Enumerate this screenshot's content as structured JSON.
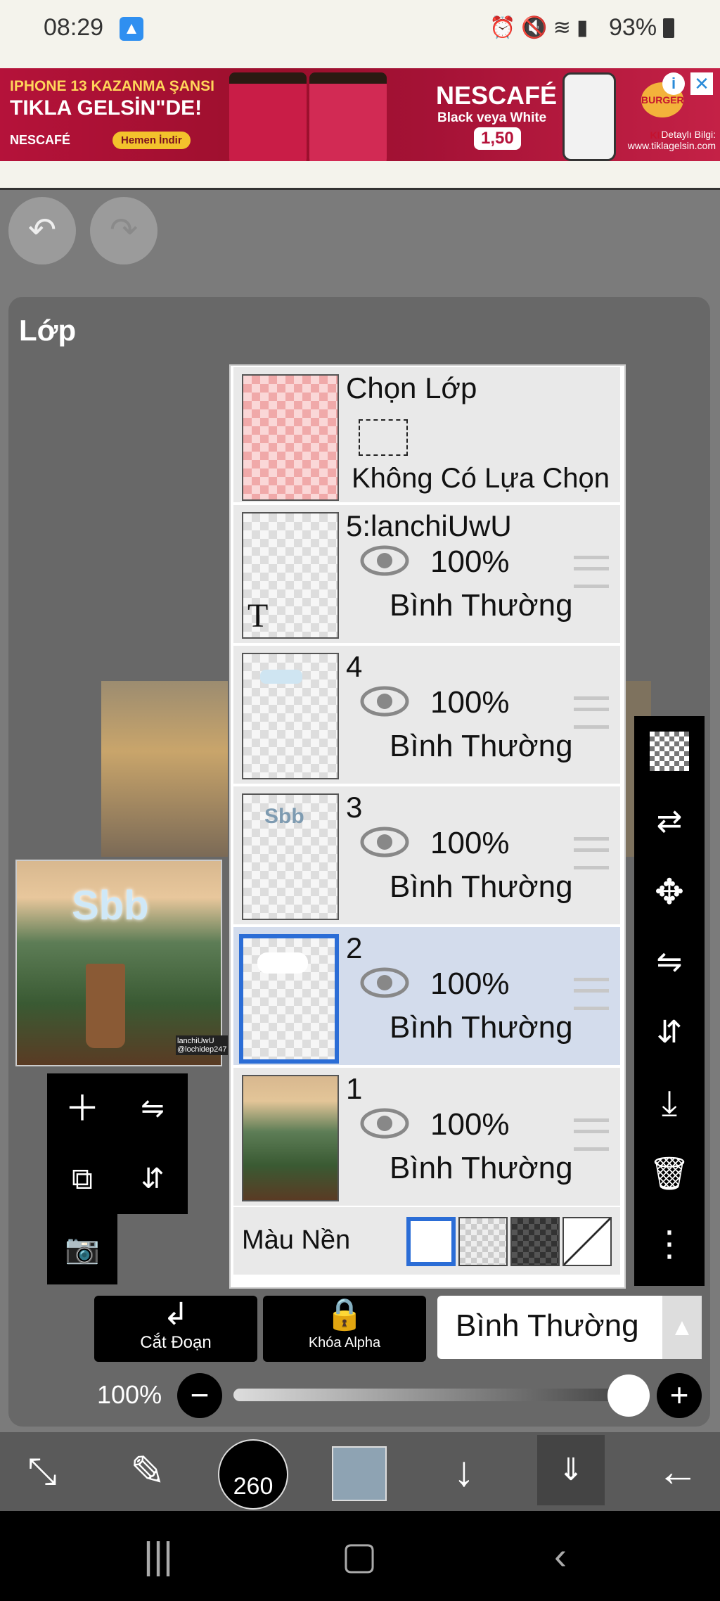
{
  "status": {
    "time": "08:29",
    "battery": "93%",
    "icons": [
      "alarm-icon",
      "mute-icon",
      "wifi-icon",
      "signal-icon"
    ]
  },
  "ad": {
    "line1": "IPHONE 13 KAZANMA ŞANSI",
    "line2": "TIKLA GELSİN\"DE!",
    "brand1": "NESCAFÉ",
    "cta": "Hemen İndir",
    "product": "NESCAFÉ",
    "product_sub": "Black veya White",
    "price": "1,50",
    "brand2": "BURGER KING",
    "details": "Detaylı Bilgi: www.tiklagelsin.com"
  },
  "panel": {
    "title": "Lớp"
  },
  "selection": {
    "title": "Chọn Lớp",
    "subtitle": "Không Có Lựa Chọn"
  },
  "layers": [
    {
      "name": "5:lanchiUwU",
      "opacity": "100%",
      "blend": "Bình Thường",
      "type": "text",
      "thumb_glyph": "T",
      "selected": false
    },
    {
      "name": "4",
      "opacity": "100%",
      "blend": "Bình Thường",
      "type": "paint",
      "selected": false
    },
    {
      "name": "3",
      "opacity": "100%",
      "blend": "Bình Thường",
      "type": "paint",
      "thumb_text": "Sbb",
      "selected": false
    },
    {
      "name": "2",
      "opacity": "100%",
      "blend": "Bình Thường",
      "type": "paint",
      "selected": true
    },
    {
      "name": "1",
      "opacity": "100%",
      "blend": "Bình Thường",
      "type": "photo",
      "selected": false
    }
  ],
  "background": {
    "label": "Màu Nền",
    "swatches": [
      "white",
      "checker-light",
      "checker-dark",
      "none"
    ],
    "selected": "white"
  },
  "controls": {
    "clip_label": "Cắt Đoạn",
    "alpha_lock_label": "Khóa Alpha",
    "blend_mode": "Bình Thường",
    "opacity_pct": "100%",
    "opacity_value": 1.0
  },
  "toolbar": {
    "brush_size": "260",
    "color": "#8ea3b3"
  },
  "artwork": {
    "title": "Sbb",
    "tag": "lanchiUwU\n@lochidep247"
  },
  "colors": {
    "selection_blue": "#2b6dd6",
    "selected_row": "#d3dcec"
  }
}
